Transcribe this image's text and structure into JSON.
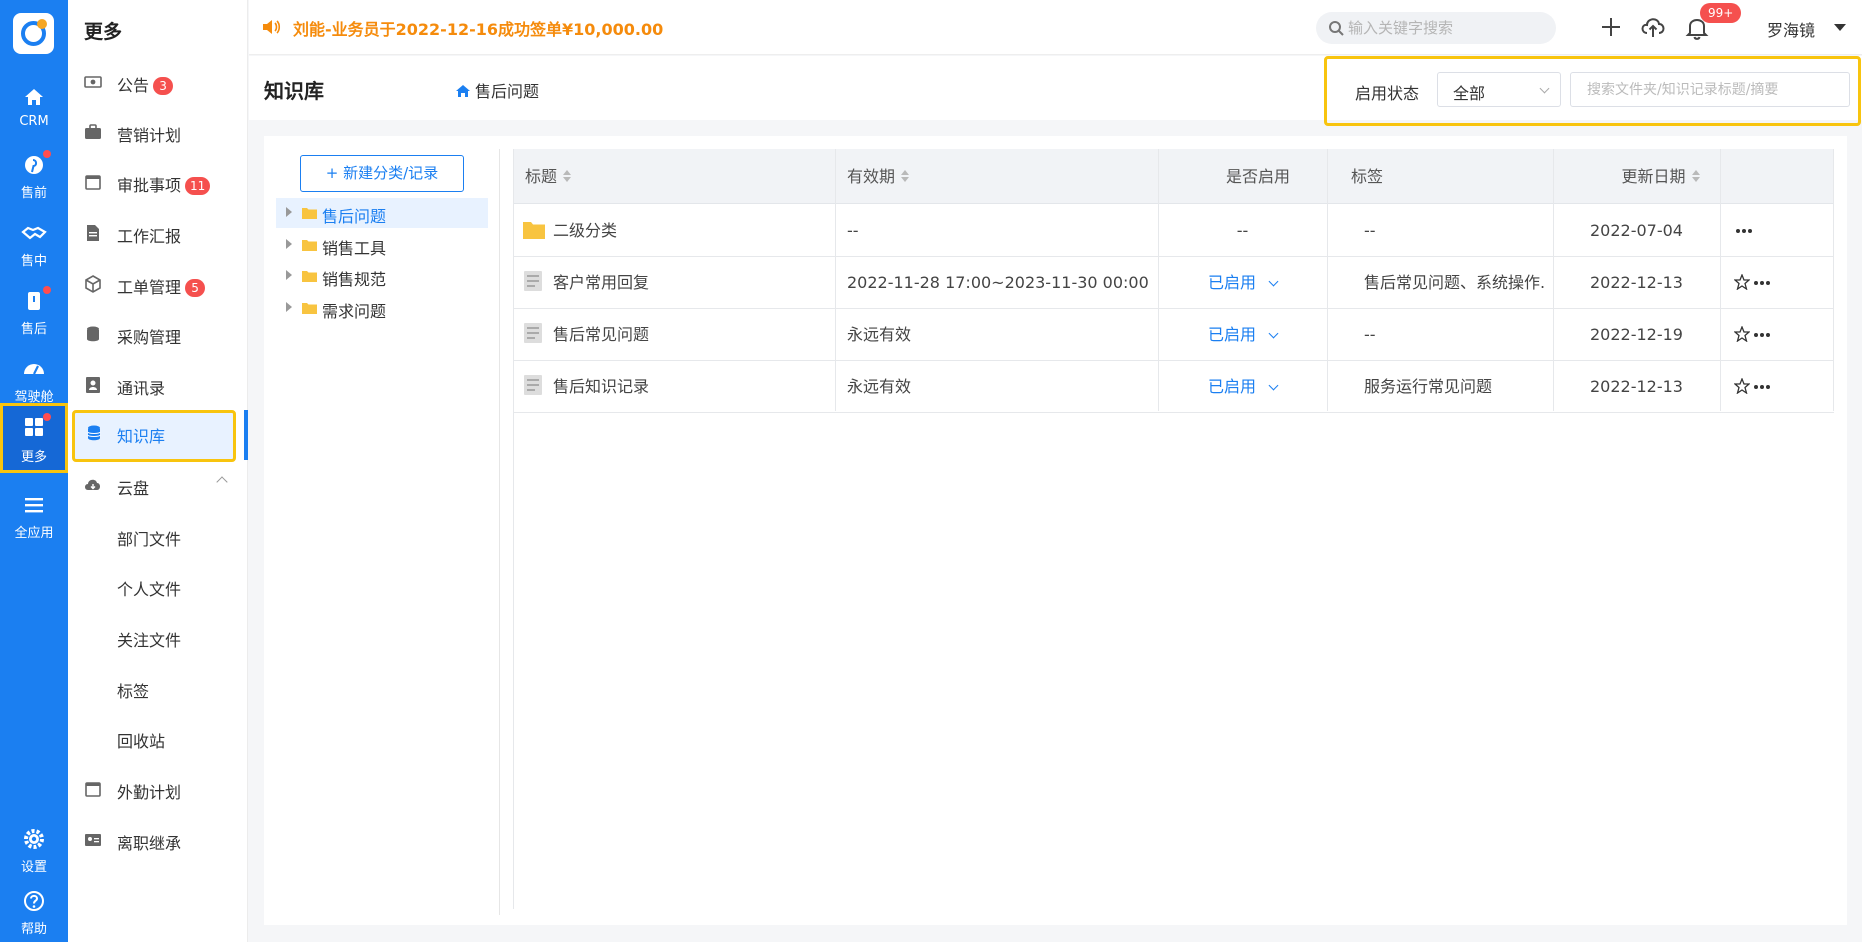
{
  "colors": {
    "primary": "#1b7ff1",
    "highlight": "#f8c40e",
    "notice": "#f58b0c",
    "badge": "#f5504e"
  },
  "rail": {
    "items": [
      {
        "label": "CRM",
        "icon": "home-icon"
      },
      {
        "label": "售前",
        "icon": "pinterest-icon"
      },
      {
        "label": "售中",
        "icon": "handshake-icon"
      },
      {
        "label": "售后",
        "icon": "tablet-icon"
      },
      {
        "label": "驾驶舱",
        "icon": "dashboard-icon"
      },
      {
        "label": "更多",
        "icon": "grid-icon"
      },
      {
        "label": "全应用",
        "icon": "list-icon"
      }
    ],
    "bottom": [
      {
        "label": "设置",
        "icon": "gear-icon"
      },
      {
        "label": "帮助",
        "icon": "help-icon"
      }
    ]
  },
  "menu": {
    "title": "更多",
    "items": [
      {
        "label": "公告",
        "badge": "3"
      },
      {
        "label": "营销计划"
      },
      {
        "label": "审批事项",
        "badge": "11"
      },
      {
        "label": "工作汇报"
      },
      {
        "label": "工单管理",
        "badge": "5"
      },
      {
        "label": "采购管理"
      },
      {
        "label": "通讯录"
      },
      {
        "label": "知识库"
      },
      {
        "label": "云盘"
      },
      {
        "label": "部门文件"
      },
      {
        "label": "个人文件"
      },
      {
        "label": "关注文件"
      },
      {
        "label": "标签"
      },
      {
        "label": "回收站"
      },
      {
        "label": "外勤计划"
      },
      {
        "label": "离职继承"
      }
    ]
  },
  "topbar": {
    "notice": "刘能-业务员于2022-12-16成功签单¥10,000.00",
    "search_placeholder": "输入关键字搜索",
    "bell_badge": "99+",
    "user": "罗海镜"
  },
  "page": {
    "title": "知识库",
    "breadcrumb": "售后问题",
    "filter_label": "启用状态",
    "filter_value": "全部",
    "filter_placeholder": "搜索文件夹/知识记录标题/摘要"
  },
  "tree": {
    "new_button": "+ 新建分类/记录",
    "nodes": [
      "售后问题",
      "销售工具",
      "销售规范",
      "需求问题"
    ]
  },
  "table": {
    "headers": [
      "标题",
      "有效期",
      "是否启用",
      "标签",
      "更新日期"
    ],
    "rows": [
      {
        "title": "二级分类",
        "validity": "--",
        "enabled": "--",
        "tags": "--",
        "updated": "2022-07-04"
      },
      {
        "title": "客户常用回复",
        "validity": "2022-11-28 17:00~2023-11-30 00:00",
        "enabled": "已启用",
        "tags": "售后常见问题、系统操作...",
        "updated": "2022-12-13"
      },
      {
        "title": "售后常见问题",
        "validity": "永远有效",
        "enabled": "已启用",
        "tags": "--",
        "updated": "2022-12-19"
      },
      {
        "title": "售后知识记录",
        "validity": "永远有效",
        "enabled": "已启用",
        "tags": "服务运行常见问题",
        "updated": "2022-12-13"
      }
    ]
  }
}
